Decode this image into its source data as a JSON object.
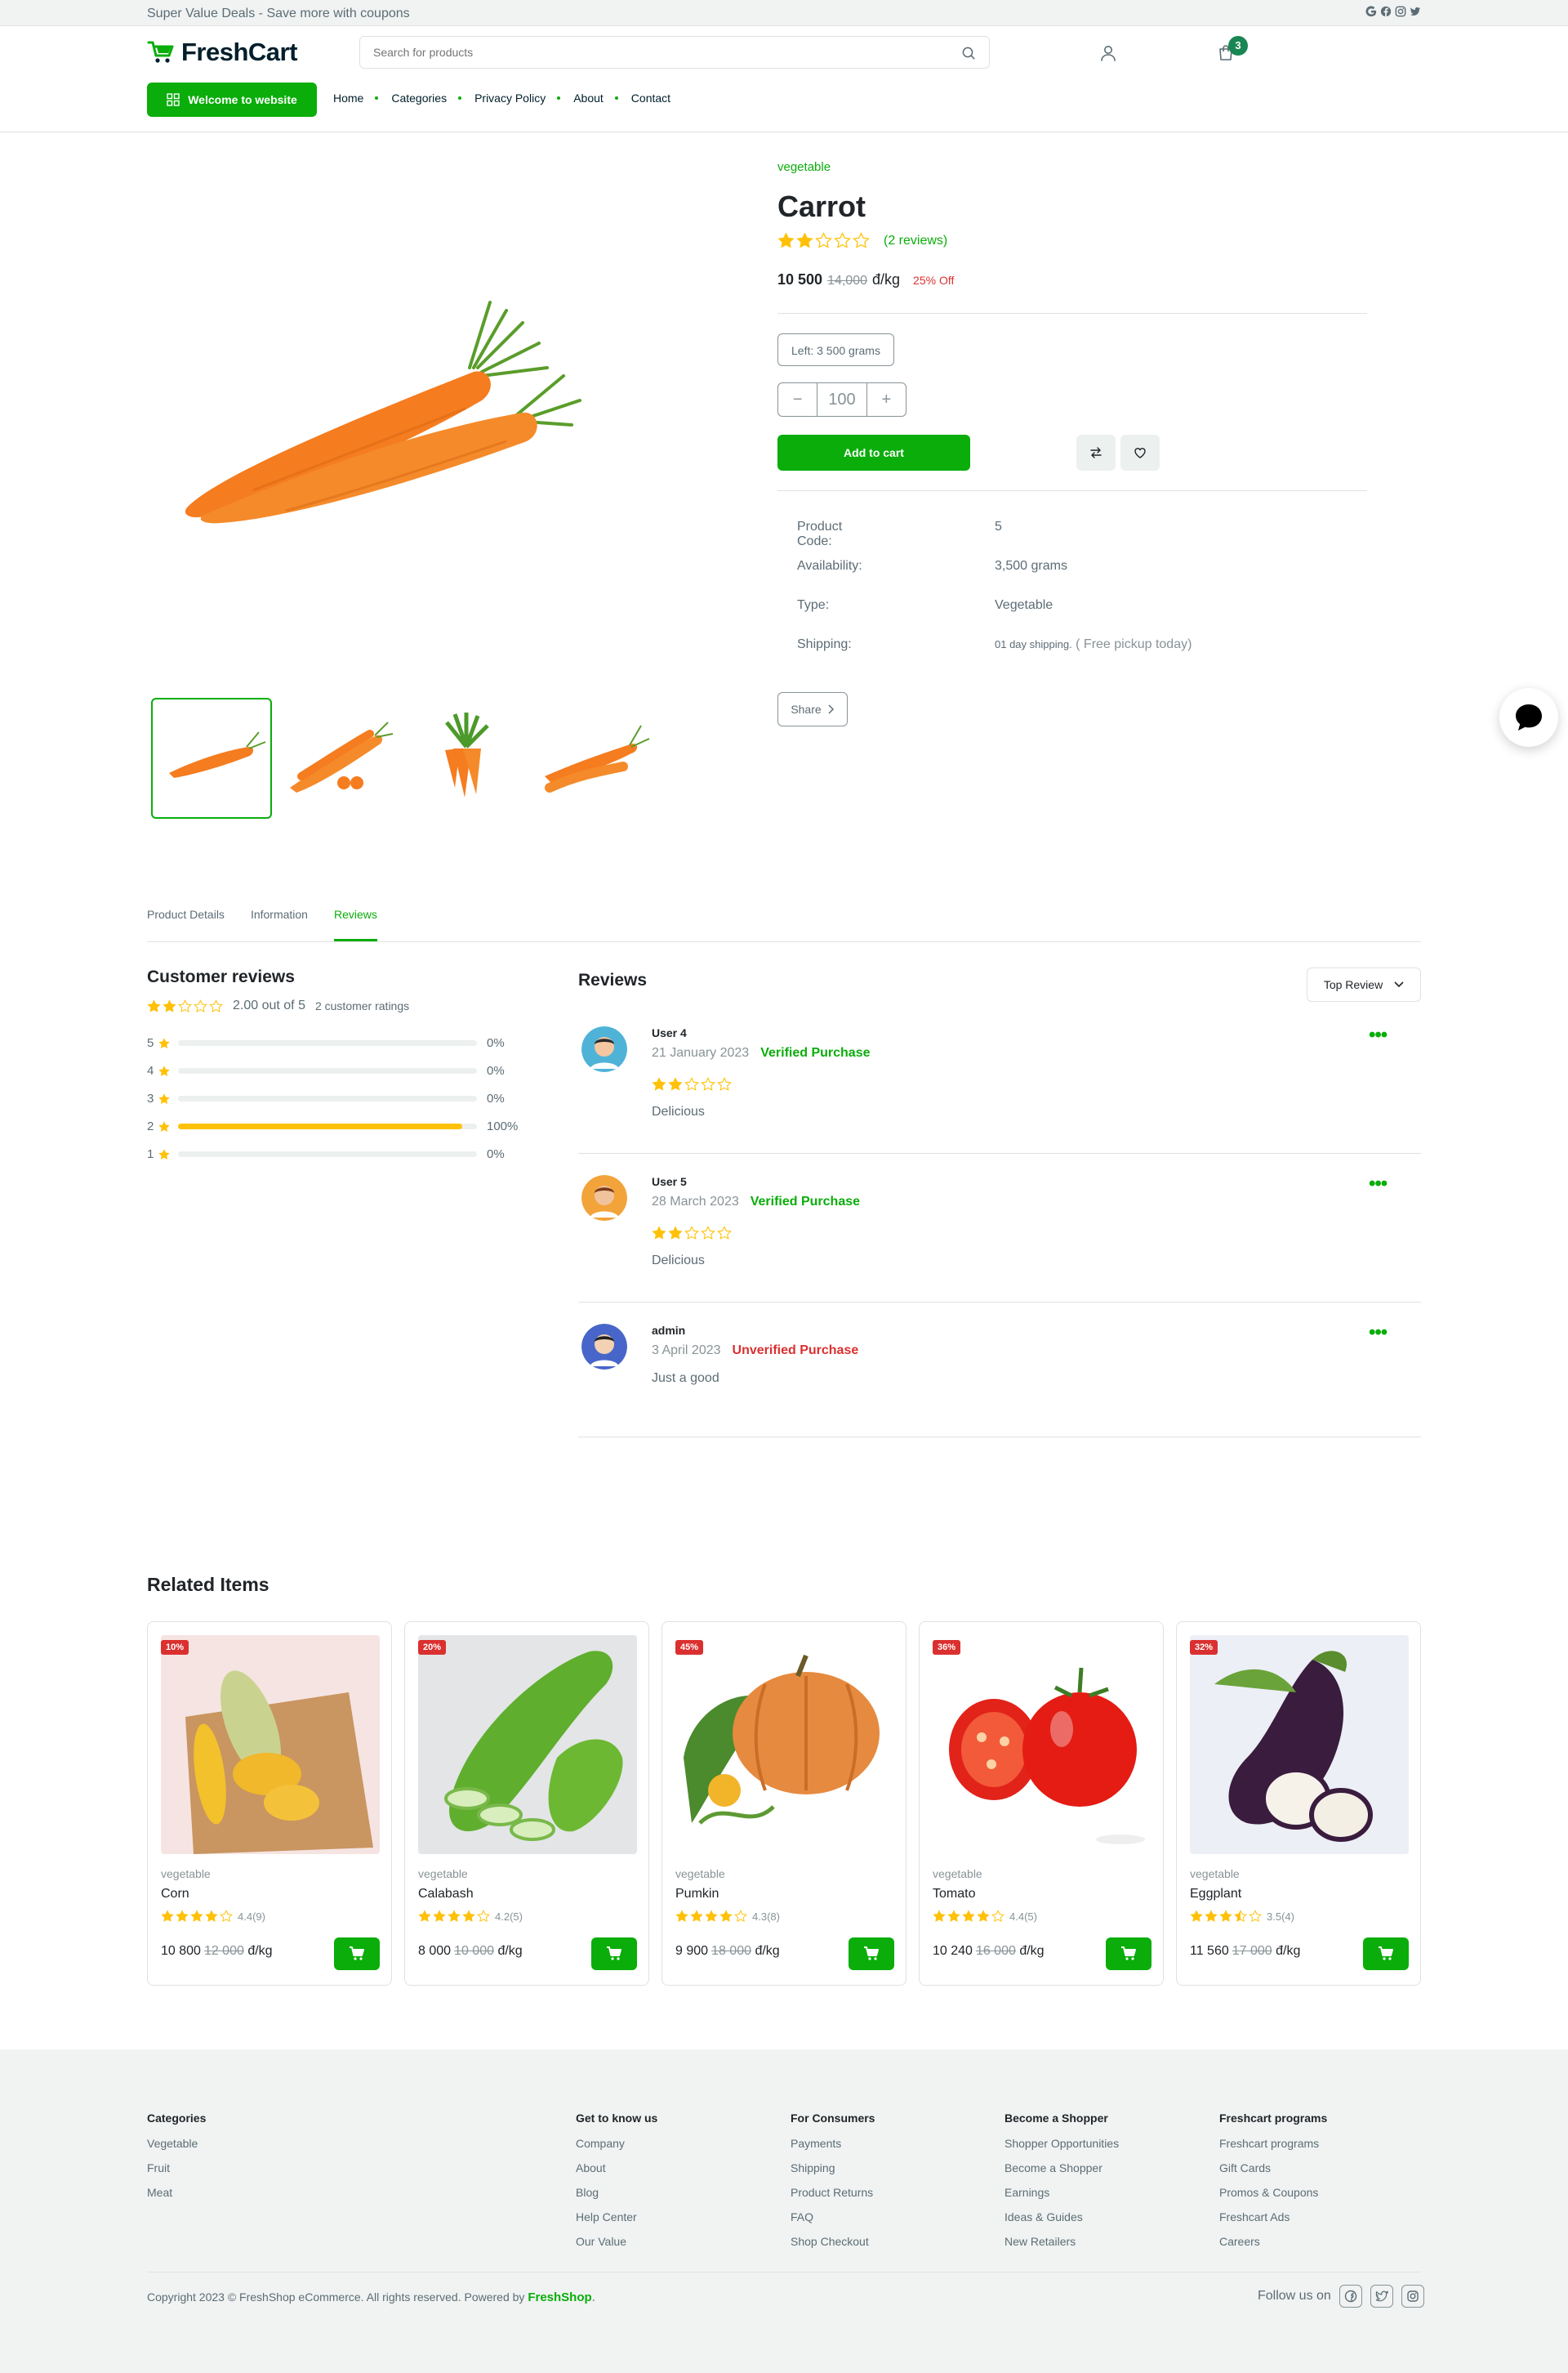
{
  "topbar": {
    "deal_text": "Super Value Deals - Save more with coupons",
    "social_icons": [
      "google-icon",
      "facebook-icon",
      "instagram-icon",
      "twitter-icon"
    ]
  },
  "header": {
    "logo": "FreshCart",
    "search_placeholder": "Search for products",
    "cart_count": "3",
    "welcome_button": "Welcome to website",
    "nav": [
      "Home",
      "Categories",
      "Privacy Policy",
      "About",
      "Contact"
    ]
  },
  "product": {
    "category": "vegetable",
    "title": "Carrot",
    "rating": 2,
    "reviews_link": "(2 reviews)",
    "price": "10 500",
    "old_price": "14,000",
    "unit": "đ/kg",
    "discount": "25% Off",
    "left": "Left: 3 500 grams",
    "quantity": "100",
    "qty_minus": "−",
    "qty_plus": "+",
    "add_to_cart": "Add to cart",
    "specs": [
      {
        "k": "Product Code:",
        "v": "5"
      },
      {
        "k": "Availability:",
        "v": "3,500 grams"
      },
      {
        "k": "Type:",
        "v": "Vegetable"
      },
      {
        "k": "Shipping:",
        "v": "01 day shipping.",
        "v2": "( Free pickup today)"
      }
    ],
    "share": "Share"
  },
  "tabs": [
    "Product Details",
    "Information",
    "Reviews"
  ],
  "customer_reviews": {
    "title": "Customer reviews",
    "summary": "2.00 out of 5",
    "ratings_count": "2 customer ratings",
    "rating": 2,
    "bars": [
      {
        "star": "5",
        "pct": "0%",
        "value": 0
      },
      {
        "star": "4",
        "pct": "0%",
        "value": 0
      },
      {
        "star": "3",
        "pct": "0%",
        "value": 0
      },
      {
        "star": "2",
        "pct": "100%",
        "value": 100
      },
      {
        "star": "1",
        "pct": "0%",
        "value": 0
      }
    ]
  },
  "reviews": {
    "title": "Reviews",
    "sort": "Top Review",
    "items": [
      {
        "name": "User 4",
        "date": "21 January 2023",
        "status": "Verified Purchase",
        "status_color": "#0aad0a",
        "rating": 2,
        "text": "Delicious"
      },
      {
        "name": "User 5",
        "date": "28 March 2023",
        "status": "Verified Purchase",
        "status_color": "#0aad0a",
        "rating": 2,
        "text": "Delicious"
      },
      {
        "name": "admin",
        "date": "3 April 2023",
        "status": "Unverified Purchase",
        "status_color": "#db3030",
        "rating": 0,
        "text": "Just a good"
      }
    ]
  },
  "related": {
    "title": "Related Items",
    "items": [
      {
        "discount": "10%",
        "category": "vegetable",
        "name": "Corn",
        "rating": 4.4,
        "rating_text": "4.4(9)",
        "price": "10 800",
        "old_price": "12 000",
        "unit": "đ/kg"
      },
      {
        "discount": "20%",
        "category": "vegetable",
        "name": "Calabash",
        "rating": 4.2,
        "rating_text": "4.2(5)",
        "price": "8 000",
        "old_price": "10 000",
        "unit": "đ/kg"
      },
      {
        "discount": "45%",
        "category": "vegetable",
        "name": "Pumkin",
        "rating": 4.3,
        "rating_text": "4.3(8)",
        "price": "9 900",
        "old_price": "18 000",
        "unit": "đ/kg"
      },
      {
        "discount": "36%",
        "category": "vegetable",
        "name": "Tomato",
        "rating": 4.4,
        "rating_text": "4.4(5)",
        "price": "10 240",
        "old_price": "16 000",
        "unit": "đ/kg"
      },
      {
        "discount": "32%",
        "category": "vegetable",
        "name": "Eggplant",
        "rating": 3.5,
        "rating_text": "3.5(4)",
        "price": "11 560",
        "old_price": "17 000",
        "unit": "đ/kg"
      }
    ]
  },
  "footer": {
    "columns": [
      {
        "title": "Categories",
        "links": [
          "Vegetable",
          "Fruit",
          "Meat"
        ]
      },
      {
        "title": "Get to know us",
        "links": [
          "Company",
          "About",
          "Blog",
          "Help Center",
          "Our Value"
        ]
      },
      {
        "title": "For Consumers",
        "links": [
          "Payments",
          "Shipping",
          "Product Returns",
          "FAQ",
          "Shop Checkout"
        ]
      },
      {
        "title": "Become a Shopper",
        "links": [
          "Shopper Opportunities",
          "Become a Shopper",
          "Earnings",
          "Ideas & Guides",
          "New Retailers"
        ]
      },
      {
        "title": "Freshcart programs",
        "links": [
          "Freshcart programs",
          "Gift Cards",
          "Promos & Coupons",
          "Freshcart Ads",
          "Careers"
        ]
      }
    ],
    "copyright": "Copyright 2023 © FreshShop eCommerce. All rights reserved. Powered by",
    "brand": "FreshShop",
    "brand_suffix": ".",
    "follow": "Follow us on"
  },
  "colors": {
    "accent": "#0aad0a",
    "danger": "#db3030",
    "star": "#ffc107"
  }
}
